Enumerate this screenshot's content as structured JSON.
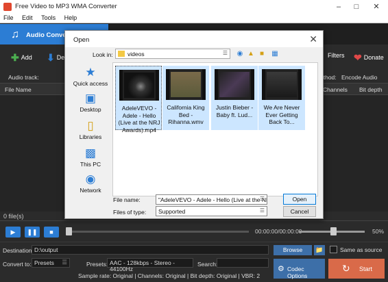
{
  "window": {
    "title": "Free Video to MP3 WMA Converter"
  },
  "menu": [
    "File",
    "Edit",
    "Tools",
    "Help"
  ],
  "tabs": {
    "audio_converter": "Audio Converte"
  },
  "toolbar": {
    "add": "Add",
    "remove": "De",
    "filters": "Filters",
    "donate": "Donate"
  },
  "audio_track_label": "Audio track:",
  "method": {
    "label": "ethod:",
    "value": "Encode Audio"
  },
  "columns": {
    "file_name": "File Name",
    "channels": "Channels",
    "bit_depth": "Bit depth"
  },
  "file_count": "0 file(s)",
  "player": {
    "time": "00:00:00/00:00:00",
    "volume_label": "50%",
    "volume_level": 0.5,
    "position": 0
  },
  "destination": {
    "label": "Destination:",
    "value": "D:\\output",
    "browse": "Browse",
    "same_as_source": "Same as source"
  },
  "convert": {
    "label": "Convert to:",
    "value": "Presets"
  },
  "presets": {
    "label": "Presets:",
    "value": "AAC - 128kbps - Stereo - 44100Hz"
  },
  "search": {
    "label": "Search:",
    "value": ""
  },
  "codec_options": "Codec Options",
  "start": "Start",
  "info_line": "Sample rate: Original | Channels: Original | Bit depth: Original | VBR: 2",
  "dialog": {
    "title": "Open",
    "look_in_label": "Look in:",
    "look_in_value": "videos",
    "places": [
      "Quick access",
      "Desktop",
      "Libraries",
      "This PC",
      "Network"
    ],
    "files": [
      {
        "name": "AdeleVEVO - Adele - Hello (Live at the NRJ Awards).mp4",
        "selected": true
      },
      {
        "name": "California King Bed - Rihanna.wmv",
        "selected": false
      },
      {
        "name": "Justin Bieber - Baby ft. Lud...",
        "selected": false
      },
      {
        "name": "We Are Never Ever Getting Back To...",
        "selected": false
      }
    ],
    "file_name_label": "File name:",
    "file_name_value": "\"AdeleVEVO - Adele - Hello (Live at the NRJ Aw",
    "files_of_type_label": "Files of type:",
    "files_of_type_value": "Supported",
    "open": "Open",
    "cancel": "Cancel"
  },
  "colors": {
    "accent": "#2c7dd4",
    "start": "#d96a49",
    "codec": "#3d6fa8"
  }
}
